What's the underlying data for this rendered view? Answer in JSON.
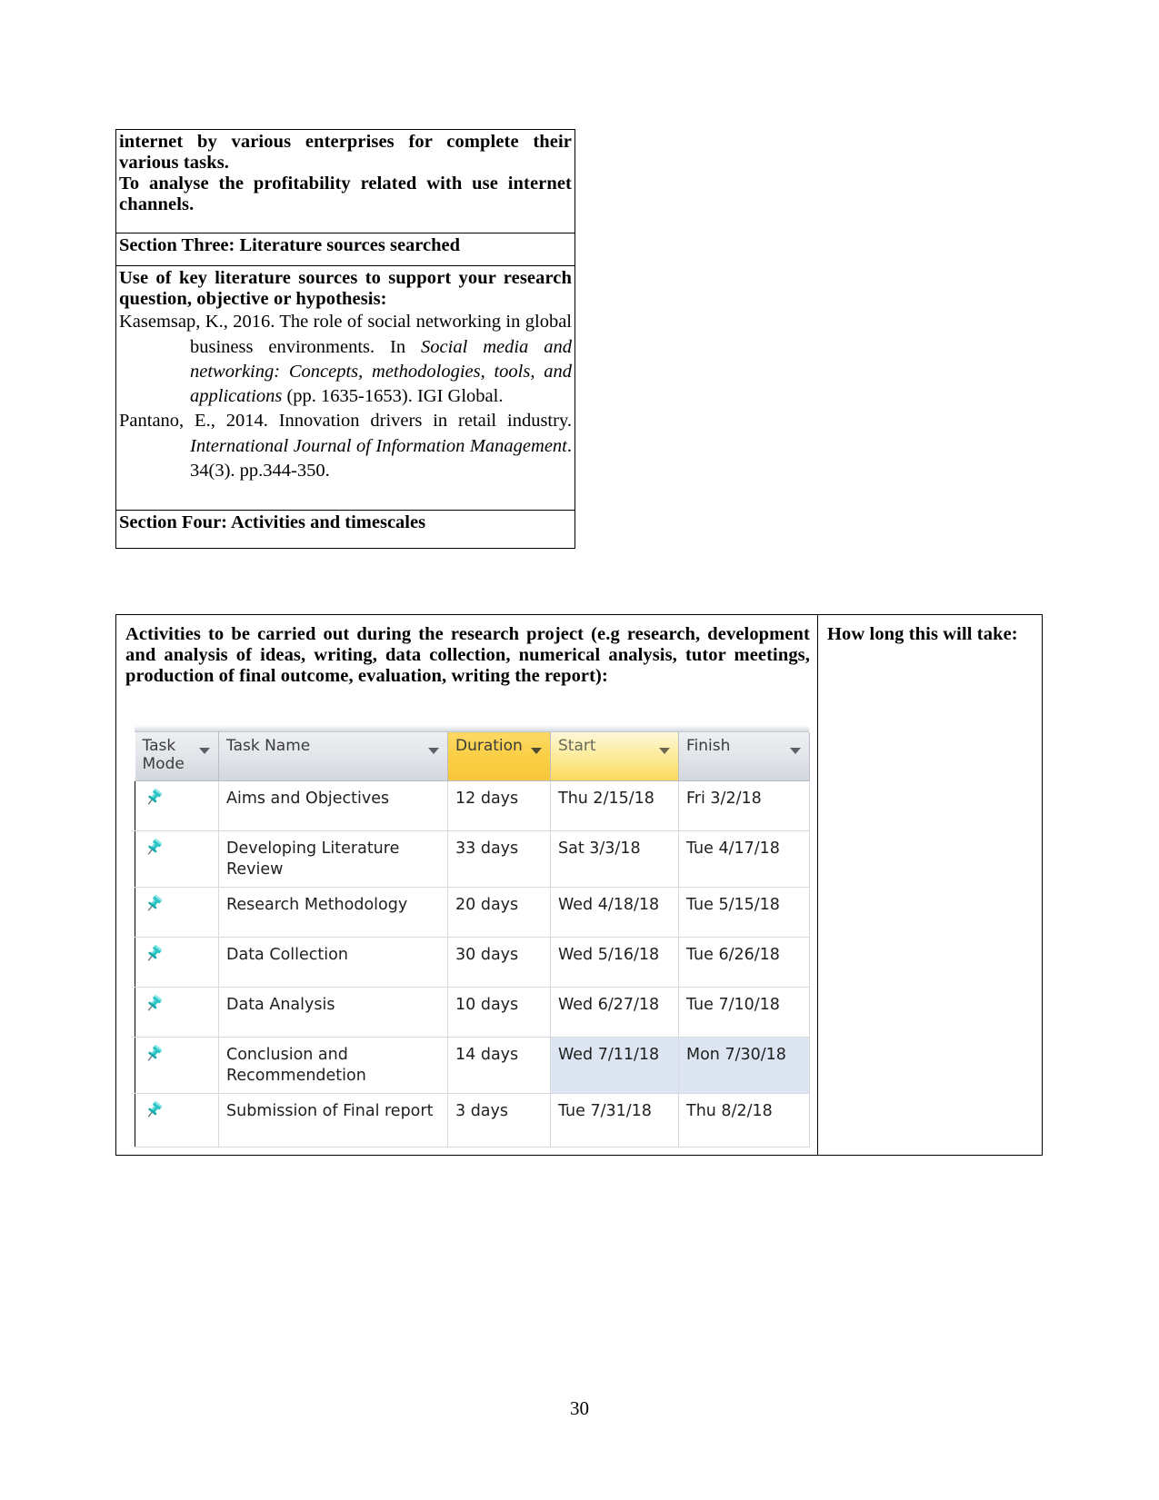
{
  "document": {
    "page_number": "30"
  },
  "upper_table": {
    "objectives_cell": {
      "line1": "internet by various enterprises for complete their various tasks.",
      "line2": "To analyse the profitability related with use internet channels."
    },
    "section_three_heading": "Section Three: Literature sources searched",
    "literature_cell": {
      "prompt": "Use of key literature sources to support your research question, objective or hypothesis:",
      "references": [
        {
          "segments": [
            {
              "text": "Kasemsap, K., 2016. The role of social networking in global business environments. In ",
              "style": "normal"
            },
            {
              "text": "Social media and networking: Concepts, methodologies, tools, and applications",
              "style": "italic"
            },
            {
              "text": " (pp. 1635-1653). IGI Global.",
              "style": "normal"
            }
          ]
        },
        {
          "segments": [
            {
              "text": "Pantano, E., 2014. Innovation drivers in retail industry. ",
              "style": "normal"
            },
            {
              "text": "International Journal of Information Management",
              "style": "italic"
            },
            {
              "text": ". 34(3). pp.344-350.",
              "style": "normal"
            }
          ]
        }
      ]
    },
    "section_four_heading": "Section Four: Activities and timescales"
  },
  "lower_table": {
    "activities_prompt": "Activities to be carried out during the research project (e.g research, development and analysis of ideas, writing, data collection, numerical analysis, tutor meetings, production of final outcome, evaluation, writing the report):",
    "how_long_prompt": "How long this will take:"
  },
  "project_grid": {
    "columns": [
      {
        "id": "task_mode",
        "label_line1": "Task",
        "label_line2": "Mode",
        "has_filter": true,
        "highlight": "none"
      },
      {
        "id": "task_name",
        "label_line1": "Task Name",
        "label_line2": "",
        "has_filter": true,
        "highlight": "none"
      },
      {
        "id": "duration",
        "label_line1": "Duration",
        "label_line2": "",
        "has_filter": true,
        "highlight": "gold"
      },
      {
        "id": "start",
        "label_line1": "Start",
        "label_line2": "",
        "has_filter": true,
        "highlight": "light-gold"
      },
      {
        "id": "finish",
        "label_line1": "Finish",
        "label_line2": "",
        "has_filter": true,
        "highlight": "none"
      }
    ],
    "rows": [
      {
        "mode_icon": "pushpin-icon",
        "task_name": "Aims and Objectives",
        "duration": "12 days",
        "start": "Thu 2/15/18",
        "finish": "Fri 3/2/18",
        "selected": false
      },
      {
        "mode_icon": "pushpin-icon",
        "task_name": "Developing Literature Review",
        "duration": "33 days",
        "start": "Sat 3/3/18",
        "finish": "Tue 4/17/18",
        "selected": false
      },
      {
        "mode_icon": "pushpin-icon",
        "task_name": "Research Methodology",
        "duration": "20 days",
        "start": "Wed 4/18/18",
        "finish": "Tue 5/15/18",
        "selected": false
      },
      {
        "mode_icon": "pushpin-icon",
        "task_name": "Data Collection",
        "duration": "30 days",
        "start": "Wed 5/16/18",
        "finish": "Tue 6/26/18",
        "selected": false
      },
      {
        "mode_icon": "pushpin-icon",
        "task_name": "Data Analysis",
        "duration": "10 days",
        "start": "Wed 6/27/18",
        "finish": "Tue 7/10/18",
        "selected": false
      },
      {
        "mode_icon": "pushpin-icon",
        "task_name": "Conclusion and Recommendetion",
        "duration": "14 days",
        "start": "Wed 7/11/18",
        "finish": "Mon 7/30/18",
        "selected": true
      },
      {
        "mode_icon": "pushpin-icon",
        "task_name": "Submission of Final report",
        "duration": "3 days",
        "start": "Tue 7/31/18",
        "finish": "Thu 8/2/18",
        "selected": false
      }
    ]
  },
  "colors": {
    "duration_header": "#fbcf45",
    "start_header": "#fdeda0",
    "selection_fill": "#dde5f3",
    "pushpin": "#2cc4c4",
    "grid_line": "#d6d9dd"
  }
}
